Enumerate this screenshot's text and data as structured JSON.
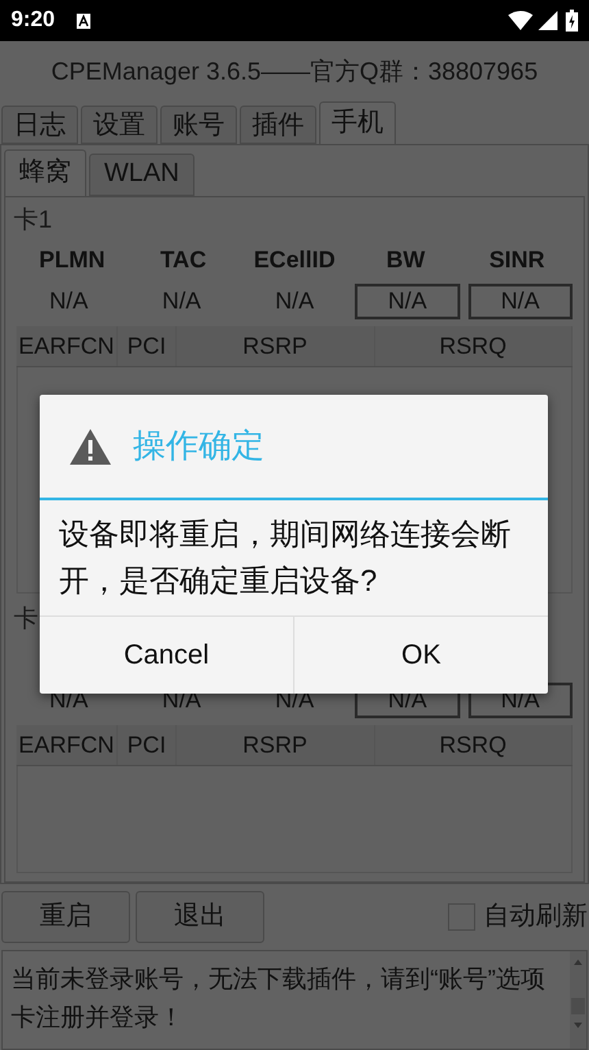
{
  "status_bar": {
    "time": "9:20"
  },
  "app_title": "CPEManager 3.6.5——官方Q群：38807965",
  "tabs": [
    {
      "label": "日志",
      "selected": false
    },
    {
      "label": "设置",
      "selected": false
    },
    {
      "label": "账号",
      "selected": false
    },
    {
      "label": "插件",
      "selected": false
    },
    {
      "label": "手机",
      "selected": true
    }
  ],
  "sub_tabs": [
    {
      "label": "蜂窝",
      "selected": true
    },
    {
      "label": "WLAN",
      "selected": false
    }
  ],
  "cards": [
    {
      "label": "卡1",
      "headers": [
        "PLMN",
        "TAC",
        "ECellID",
        "BW",
        "SINR"
      ],
      "values": [
        {
          "text": "N/A",
          "boxed": false
        },
        {
          "text": "N/A",
          "boxed": false
        },
        {
          "text": "N/A",
          "boxed": false
        },
        {
          "text": "N/A",
          "boxed": true
        },
        {
          "text": "N/A",
          "boxed": true
        }
      ],
      "cell_columns": [
        "EARFCN",
        "PCI",
        "RSRP",
        "RSRQ"
      ]
    },
    {
      "label": "卡",
      "values": [
        {
          "text": "N/A",
          "boxed": false
        },
        {
          "text": "N/A",
          "boxed": false
        },
        {
          "text": "N/A",
          "boxed": false
        },
        {
          "text": "N/A",
          "boxed": true
        },
        {
          "text": "N/A",
          "boxed": true
        }
      ],
      "cell_columns": [
        "EARFCN",
        "PCI",
        "RSRP",
        "RSRQ"
      ]
    }
  ],
  "buttons": [
    "重启",
    "退出"
  ],
  "auto_refresh": {
    "label": "自动刷新",
    "checked": false
  },
  "log": "当前未登录账号，无法下载插件，请到“账号”选项卡注册并登录！",
  "dialog": {
    "title": "操作确定",
    "message": "设备即将重启，期间网络连接会断开，是否确定重启设备?",
    "buttons": [
      "Cancel",
      "OK"
    ]
  }
}
